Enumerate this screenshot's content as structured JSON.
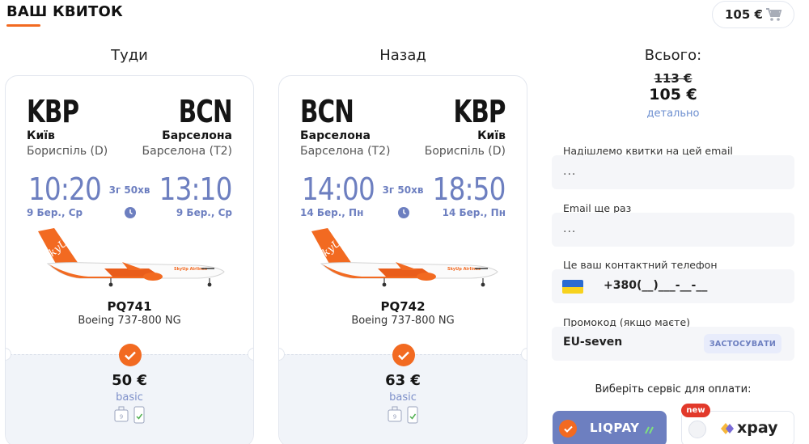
{
  "header": {
    "title": "ВАШ КВИТОК",
    "cart_price": "105 €",
    "accent": "#f26a21"
  },
  "columns": {
    "outbound_title": "Туди",
    "return_title": "Назад",
    "total_title": "Всього:"
  },
  "outbound": {
    "from_code": "KBP",
    "from_city": "Київ",
    "from_airport": "Бориспіль (D)",
    "to_code": "BCN",
    "to_city": "Барселона",
    "to_airport": "Барселона (T2)",
    "depart_time": "10:20",
    "depart_date": "9 Бер., Ср",
    "arrive_time": "13:10",
    "arrive_date": "9 Бер., Ср",
    "duration": "3г 50хв",
    "flight_number": "PQ741",
    "aircraft": "Boeing 737-800 NG",
    "fare_price": "50 €",
    "fare_class": "basic"
  },
  "return": {
    "from_code": "BCN",
    "from_city": "Барселона",
    "from_airport": "Барселона (T2)",
    "to_code": "KBP",
    "to_city": "Київ",
    "to_airport": "Бориспіль (D)",
    "depart_time": "14:00",
    "depart_date": "14 Бер., Пн",
    "arrive_time": "18:50",
    "arrive_date": "14 Бер., Пн",
    "duration": "3г 50хв",
    "flight_number": "PQ742",
    "aircraft": "Boeing 737-800 NG",
    "fare_price": "63 €",
    "fare_class": "basic"
  },
  "plane_livery": {
    "brand": "SkyUp",
    "tail_text": "SkyUp",
    "body_text": "SkyUp Airlines"
  },
  "bag_icon_number": "9",
  "summary": {
    "old_price": "113 €",
    "new_price": "105 €",
    "details_link": "детально"
  },
  "form": {
    "email_label": "Надішлемо квитки на цей email",
    "email_value": "...",
    "email_repeat_label": "Email ще раз",
    "email_repeat_value": "...",
    "phone_label": "Це ваш контактний телефон",
    "phone_value": "+380(__)___-__-__",
    "promo_label": "Промокод (якщо маєте)",
    "promo_value": "EU-seven",
    "apply_button": "ЗАСТОСУВАТИ"
  },
  "payment": {
    "label": "Виберіть сервіс для оплати:",
    "options": [
      {
        "name": "LIQPAY",
        "selected": true
      },
      {
        "name": "xpay",
        "selected": false,
        "badge": "new"
      }
    ],
    "selected_color": "#6d7fc0"
  }
}
